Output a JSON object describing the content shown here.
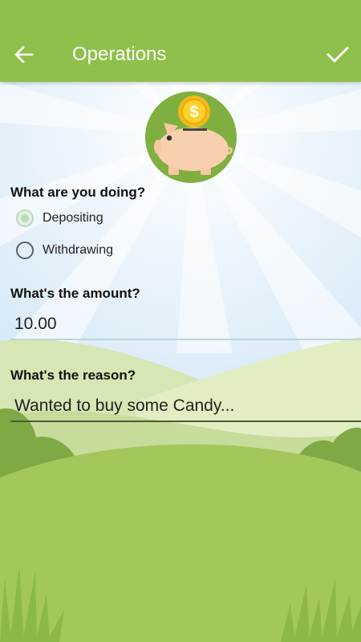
{
  "app_bar": {
    "title": "Operations",
    "back_icon": "arrow-left-icon",
    "confirm_icon": "check-icon",
    "background_color": "#8fc04b"
  },
  "logo": {
    "icon": "piggy-bank-coin-icon",
    "coin_symbol": "$"
  },
  "operation": {
    "question": "What are you doing?",
    "options": [
      {
        "label": "Depositing",
        "selected": true
      },
      {
        "label": "Withdrawing",
        "selected": false
      }
    ]
  },
  "amount": {
    "question": "What's the amount?",
    "value": "10.00"
  },
  "reason": {
    "question": "What's the reason?",
    "value": "Wanted to buy some Candy..."
  }
}
